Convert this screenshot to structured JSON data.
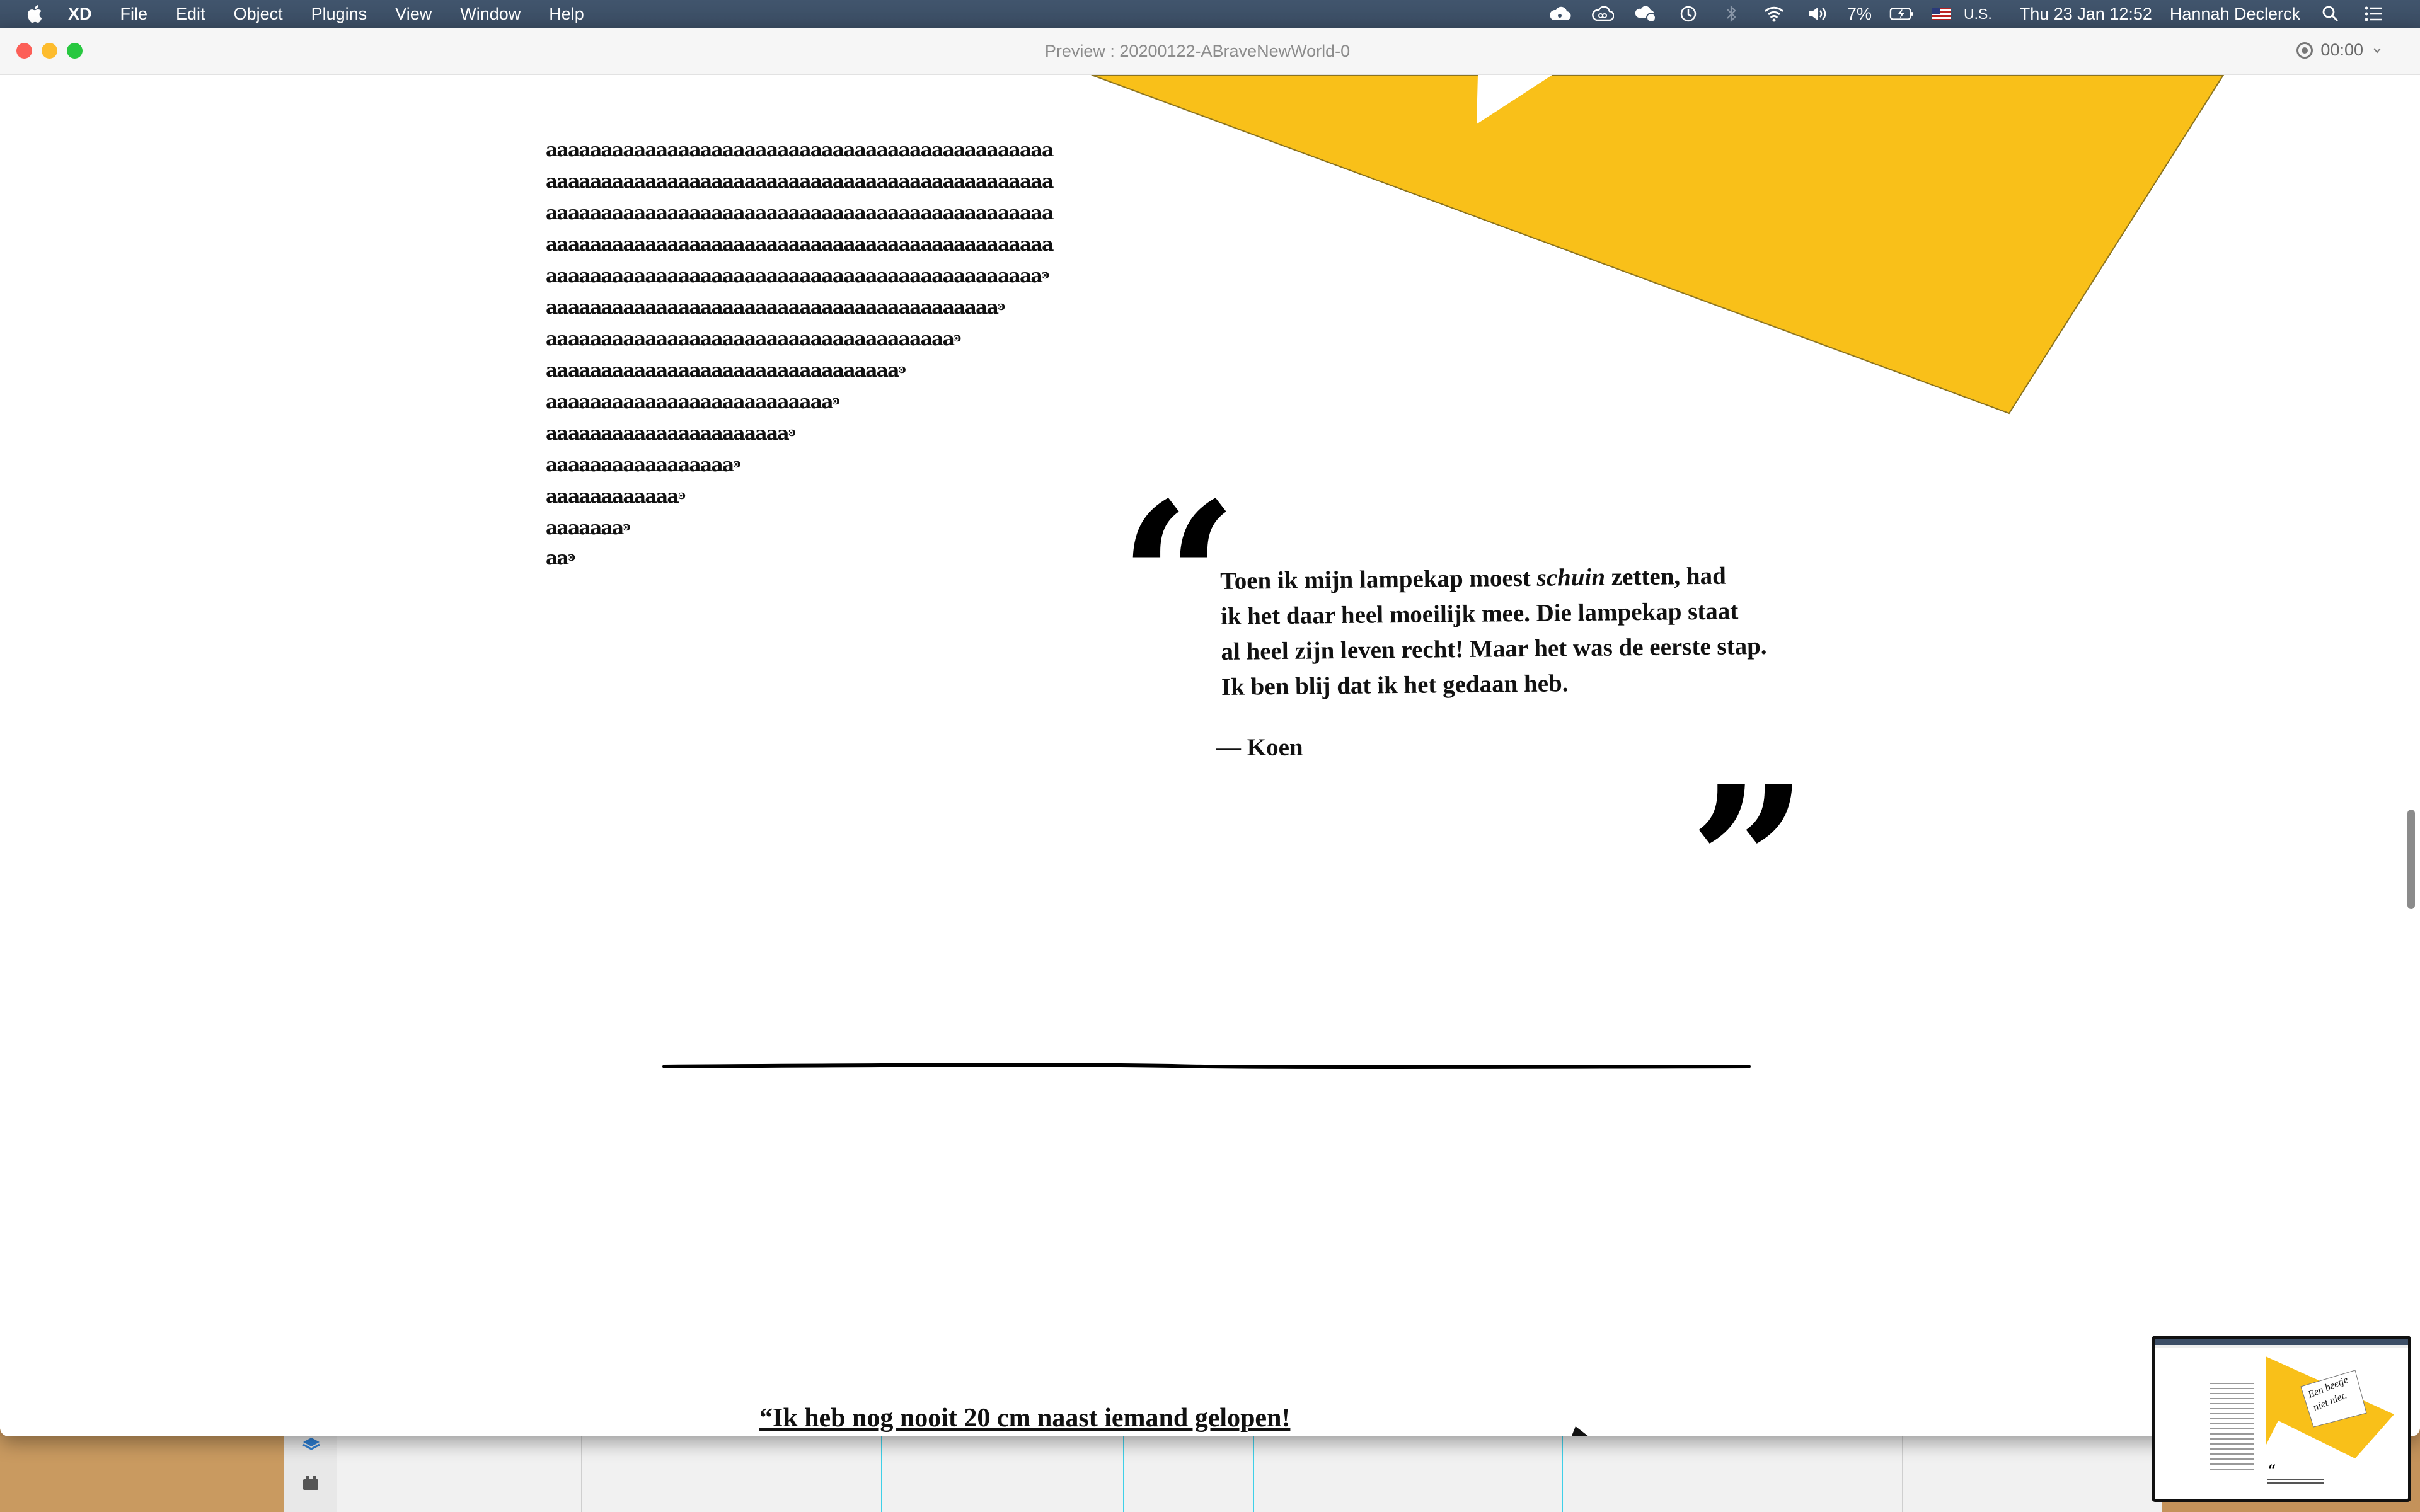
{
  "menubar": {
    "app": "XD",
    "items": [
      "File",
      "Edit",
      "Object",
      "Plugins",
      "View",
      "Window",
      "Help"
    ],
    "battery": "7%",
    "input_source": "U.S.",
    "datetime": "Thu 23 Jan  12:52",
    "user": "Hannah Declerck"
  },
  "window": {
    "title": "Preview : 20200122-ABraveNewWorld-0",
    "timer": "00:00"
  },
  "page": {
    "a_lines": [
      {
        "text": "aaaaaaaaaaaaaaaaaaaaaaaaaaaaaaaaaaaaaaaaaaaaaa",
        "curl": ""
      },
      {
        "text": "aaaaaaaaaaaaaaaaaaaaaaaaaaaaaaaaaaaaaaaaaaaaaa",
        "curl": ""
      },
      {
        "text": "aaaaaaaaaaaaaaaaaaaaaaaaaaaaaaaaaaaaaaaaaaaaaa",
        "curl": ""
      },
      {
        "text": "aaaaaaaaaaaaaaaaaaaaaaaaaaaaaaaaaaaaaaaaaaaaaa",
        "curl": ""
      },
      {
        "text": "aaaaaaaaaaaaaaaaaaaaaaaaaaaaaaaaaaaaaaaaaaaaa",
        "curl": "ͽ"
      },
      {
        "text": "aaaaaaaaaaaaaaaaaaaaaaaaaaaaaaaaaaaaaaaaa",
        "curl": "ͽ"
      },
      {
        "text": "aaaaaaaaaaaaaaaaaaaaaaaaaaaaaaaaaaaaa",
        "curl": "ͽ"
      },
      {
        "text": "aaaaaaaaaaaaaaaaaaaaaaaaaaaaaaaa",
        "curl": "ͽ"
      },
      {
        "text": "aaaaaaaaaaaaaaaaaaaaaaaaaa",
        "curl": "ͽ"
      },
      {
        "text": "aaaaaaaaaaaaaaaaaaaaaa",
        "curl": "ͽ"
      },
      {
        "text": "aaaaaaaaaaaaaaaaa",
        "curl": "ͽ"
      },
      {
        "text": "aaaaaaaaaaaa",
        "curl": "ͽ"
      },
      {
        "text": "aaaaaaa",
        "curl": "ͽ"
      },
      {
        "text": "aa",
        "curl": "ͽ"
      }
    ],
    "open_quote": "“",
    "close_quote": "”",
    "quote_lines": [
      {
        "before": "Toen ik mijn lampekap moest ",
        "em": "schuin",
        "after": " zetten, had"
      },
      {
        "before": "ik het daar heel moeilijk mee. Die lampekap staat",
        "em": "",
        "after": ""
      },
      {
        "before": "al heel zijn leven recht! Maar het was de eerste stap.",
        "em": "",
        "after": ""
      },
      {
        "before": "Ik ben blij dat ik het gedaan heb.",
        "em": "",
        "after": ""
      }
    ],
    "quote_author": "— Koen",
    "bottom_quote": "“Ik heb nog nooit 20 cm naast iemand gelopen!",
    "accent_color": "#f9c019"
  },
  "thumbnail": {
    "text_lines": [
      "Een beetje",
      "niet niet."
    ],
    "quote_mark": "“"
  }
}
